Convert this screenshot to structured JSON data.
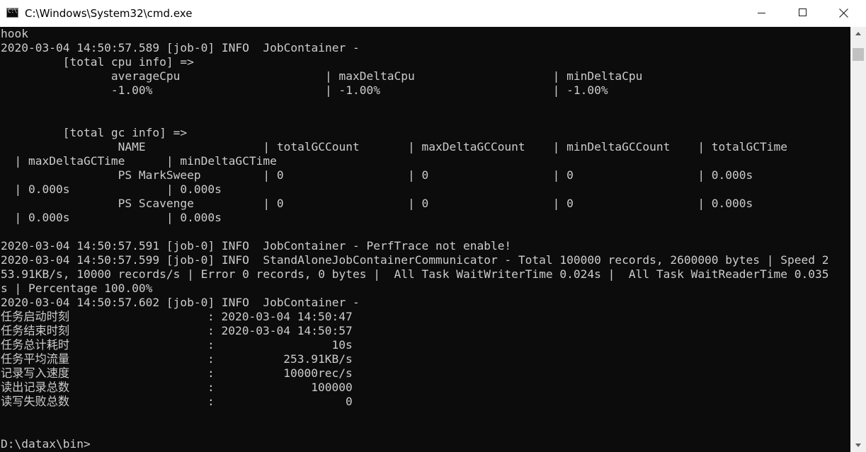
{
  "window": {
    "title": "C:\\Windows\\System32\\cmd.exe",
    "icon_glyph": "C:\\."
  },
  "theme": {
    "console_background": "#0c0c0c",
    "console_foreground": "#cccccc",
    "titlebar_background": "#ffffff"
  },
  "icons": {
    "app": "cmd-console-icon",
    "minimize": "minimize-icon",
    "maximize": "maximize-icon",
    "close": "close-icon",
    "scroll_up": "arrow-up-icon",
    "scroll_down": "arrow-down-icon"
  },
  "console": {
    "lines": [
      "hook",
      "2020-03-04 14:50:57.589 [job-0] INFO  JobContainer -",
      "         [total cpu info] =>",
      "                averageCpu                     | maxDeltaCpu                    | minDeltaCpu",
      "                -1.00%                         | -1.00%                         | -1.00%",
      "",
      "",
      "         [total gc info] =>",
      "                 NAME                 | totalGCCount       | maxDeltaGCCount    | minDeltaGCCount    | totalGCTime",
      "  | maxDeltaGCTime      | minDeltaGCTime",
      "                 PS MarkSweep         | 0                  | 0                  | 0                  | 0.000s",
      "  | 0.000s              | 0.000s",
      "                 PS Scavenge          | 0                  | 0                  | 0                  | 0.000s",
      "  | 0.000s              | 0.000s",
      "",
      "2020-03-04 14:50:57.591 [job-0] INFO  JobContainer - PerfTrace not enable!",
      "2020-03-04 14:50:57.599 [job-0] INFO  StandAloneJobContainerCommunicator - Total 100000 records, 2600000 bytes | Speed 2",
      "53.91KB/s, 10000 records/s | Error 0 records, 0 bytes |  All Task WaitWriterTime 0.024s |  All Task WaitReaderTime 0.035",
      "s | Percentage 100.00%",
      "2020-03-04 14:50:57.602 [job-0] INFO  JobContainer -",
      "任务启动时刻                    : 2020-03-04 14:50:47",
      "任务结束时刻                    : 2020-03-04 14:50:57",
      "任务总计耗时                    :                 10s",
      "任务平均流量                    :          253.91KB/s",
      "记录写入速度                    :          10000rec/s",
      "读出记录总数                    :              100000",
      "读写失败总数                    :                   0",
      "",
      "",
      "D:\\datax\\bin>"
    ]
  }
}
